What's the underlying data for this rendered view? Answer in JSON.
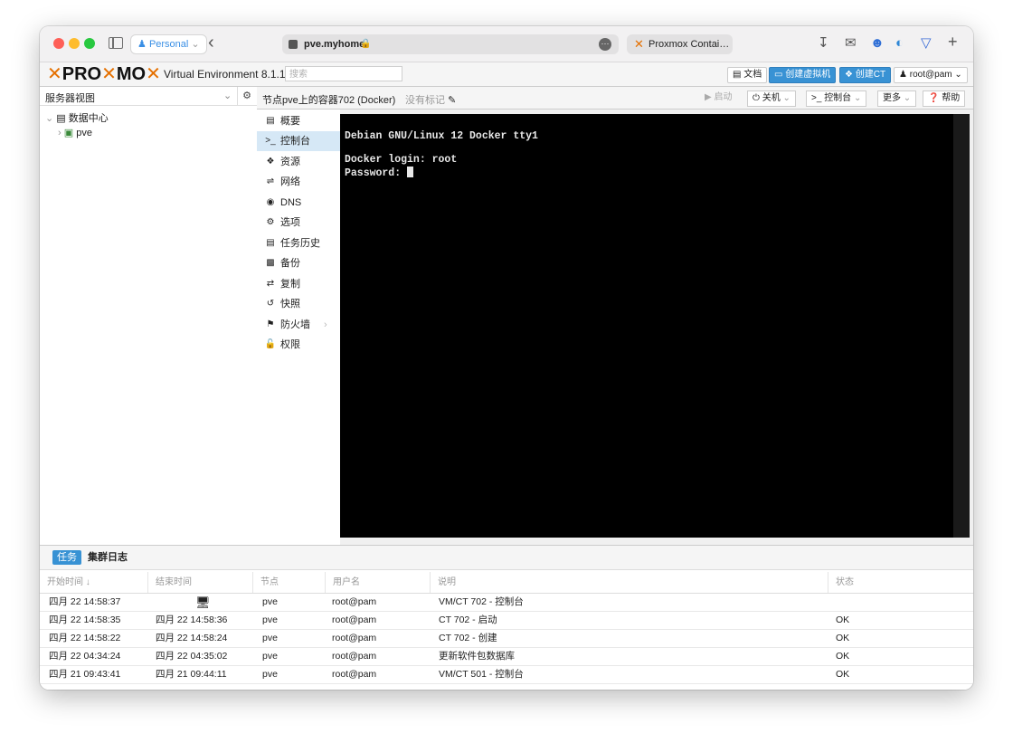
{
  "browser": {
    "profile": "Personal",
    "url": "pve.myhome",
    "second_tab": "Proxmox Contai…"
  },
  "pve": {
    "logo_text": "PROXMOX",
    "version_text": "Virtual Environment 8.1.10",
    "search_placeholder": "搜索",
    "docs_btn": "文档",
    "create_vm_btn": "创建虚拟机",
    "create_ct_btn": "创建CT",
    "user_btn": "root@pam"
  },
  "tree": {
    "view_label": "服务器视图",
    "datacenter": "数据中心",
    "node": "pve"
  },
  "container_bar": {
    "title": "节点pve上的容器702 (Docker)",
    "tags": "没有标记",
    "start_btn": "启动",
    "shutdown_btn": "关机",
    "console_btn": "控制台",
    "more_btn": "更多",
    "help_btn": "帮助"
  },
  "nav": {
    "items": [
      {
        "label": "概要",
        "icon": "book-icon"
      },
      {
        "label": "控制台",
        "icon": "terminal-icon"
      },
      {
        "label": "资源",
        "icon": "cube-icon"
      },
      {
        "label": "网络",
        "icon": "exchange-icon"
      },
      {
        "label": "DNS",
        "icon": "globe-icon"
      },
      {
        "label": "选项",
        "icon": "gear-icon"
      },
      {
        "label": "任务历史",
        "icon": "list-icon"
      },
      {
        "label": "备份",
        "icon": "floppy-icon"
      },
      {
        "label": "复制",
        "icon": "retweet-icon"
      },
      {
        "label": "快照",
        "icon": "history-icon"
      },
      {
        "label": "防火墙",
        "icon": "shield-icon"
      },
      {
        "label": "权限",
        "icon": "unlock-icon"
      }
    ],
    "active_index": 1
  },
  "console": {
    "line1": "Debian GNU/Linux 12 Docker tty1",
    "line2": "Docker login: root",
    "line3": "Password: "
  },
  "tasks": {
    "tab_tasks": "任务",
    "tab_cluster_log": "集群日志",
    "headers": [
      "开始时间 ↓",
      "结束时间",
      "节点",
      "用户名",
      "说明",
      "状态"
    ],
    "rows": [
      {
        "start": "四月 22 14:58:37",
        "end": "",
        "node": "pve",
        "user": "root@pam",
        "desc": "VM/CT 702 - 控制台",
        "status": ""
      },
      {
        "start": "四月 22 14:58:35",
        "end": "四月 22 14:58:36",
        "node": "pve",
        "user": "root@pam",
        "desc": "CT 702 - 启动",
        "status": "OK"
      },
      {
        "start": "四月 22 14:58:22",
        "end": "四月 22 14:58:24",
        "node": "pve",
        "user": "root@pam",
        "desc": "CT 702 - 创建",
        "status": "OK"
      },
      {
        "start": "四月 22 04:34:24",
        "end": "四月 22 04:35:02",
        "node": "pve",
        "user": "root@pam",
        "desc": "更新软件包数据库",
        "status": "OK"
      },
      {
        "start": "四月 21 09:43:41",
        "end": "四月 21 09:44:11",
        "node": "pve",
        "user": "root@pam",
        "desc": "VM/CT 501 - 控制台",
        "status": "OK"
      }
    ]
  }
}
